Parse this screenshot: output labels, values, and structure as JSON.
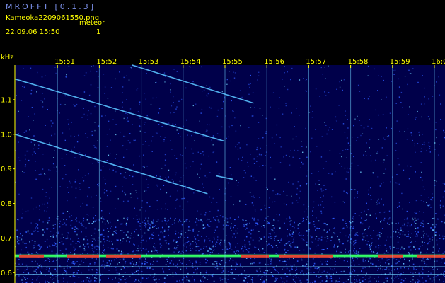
{
  "header": {
    "app_title": "MROFFT [0.1.3]",
    "file_name": "Kameoka2209061550.png",
    "meteor_label": "meteor",
    "datetime": "22.09.06 15:50",
    "meteor_count": "1"
  },
  "colors": {
    "background": "#000000",
    "plot_background": "#00004a",
    "axis_text": "#ffff00",
    "title_text": "#7a8ee6",
    "grid_line": "#6fd3ff",
    "band_hot": "#ff2a2a",
    "band_warm": "#33ff66",
    "noise": "#2e5bff"
  },
  "chart_data": {
    "type": "heatmap",
    "ylabel": "kHz",
    "x_ticks": [
      "15:51",
      "15:52",
      "15:53",
      "15:54",
      "15:55",
      "15:56",
      "15:57",
      "15:58",
      "15:59",
      "16:00"
    ],
    "x_range": [
      "15:50",
      "16:00"
    ],
    "y_ticks": [
      0.6,
      0.7,
      0.8,
      0.9,
      1.0,
      1.1
    ],
    "ylim": [
      0.57,
      1.2
    ],
    "grid": "vertical at minute marks",
    "signals": [
      {
        "name": "carrier",
        "freq_khz": 0.648
      },
      {
        "name": "ref_line",
        "freq_khz": 0.617
      },
      {
        "name": "ref_line",
        "freq_khz": 0.595
      }
    ],
    "traces": [
      {
        "x": [
          "15:50.0",
          "15:54.6"
        ],
        "y": [
          1.0,
          0.828
        ]
      },
      {
        "x": [
          "15:50.0",
          "15:55.0"
        ],
        "y": [
          1.16,
          0.98
        ]
      },
      {
        "x": [
          "15:52.8",
          "15:55.7"
        ],
        "y": [
          1.2,
          1.09
        ]
      },
      {
        "x": [
          "15:54.8",
          "15:55.2"
        ],
        "y": [
          0.88,
          0.87
        ]
      }
    ]
  }
}
